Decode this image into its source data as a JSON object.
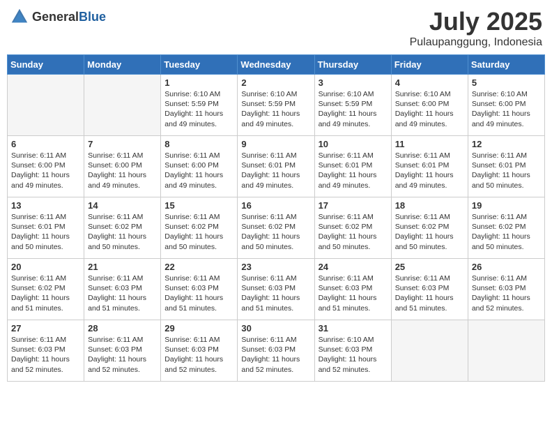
{
  "header": {
    "logo_general": "General",
    "logo_blue": "Blue",
    "month_year": "July 2025",
    "location": "Pulaupanggung, Indonesia"
  },
  "days_of_week": [
    "Sunday",
    "Monday",
    "Tuesday",
    "Wednesday",
    "Thursday",
    "Friday",
    "Saturday"
  ],
  "weeks": [
    [
      {
        "day": "",
        "empty": true
      },
      {
        "day": "",
        "empty": true
      },
      {
        "day": "1",
        "lines": [
          "Sunrise: 6:10 AM",
          "Sunset: 5:59 PM",
          "Daylight: 11 hours",
          "and 49 minutes."
        ]
      },
      {
        "day": "2",
        "lines": [
          "Sunrise: 6:10 AM",
          "Sunset: 5:59 PM",
          "Daylight: 11 hours",
          "and 49 minutes."
        ]
      },
      {
        "day": "3",
        "lines": [
          "Sunrise: 6:10 AM",
          "Sunset: 5:59 PM",
          "Daylight: 11 hours",
          "and 49 minutes."
        ]
      },
      {
        "day": "4",
        "lines": [
          "Sunrise: 6:10 AM",
          "Sunset: 6:00 PM",
          "Daylight: 11 hours",
          "and 49 minutes."
        ]
      },
      {
        "day": "5",
        "lines": [
          "Sunrise: 6:10 AM",
          "Sunset: 6:00 PM",
          "Daylight: 11 hours",
          "and 49 minutes."
        ]
      }
    ],
    [
      {
        "day": "6",
        "lines": [
          "Sunrise: 6:11 AM",
          "Sunset: 6:00 PM",
          "Daylight: 11 hours",
          "and 49 minutes."
        ]
      },
      {
        "day": "7",
        "lines": [
          "Sunrise: 6:11 AM",
          "Sunset: 6:00 PM",
          "Daylight: 11 hours",
          "and 49 minutes."
        ]
      },
      {
        "day": "8",
        "lines": [
          "Sunrise: 6:11 AM",
          "Sunset: 6:00 PM",
          "Daylight: 11 hours",
          "and 49 minutes."
        ]
      },
      {
        "day": "9",
        "lines": [
          "Sunrise: 6:11 AM",
          "Sunset: 6:01 PM",
          "Daylight: 11 hours",
          "and 49 minutes."
        ]
      },
      {
        "day": "10",
        "lines": [
          "Sunrise: 6:11 AM",
          "Sunset: 6:01 PM",
          "Daylight: 11 hours",
          "and 49 minutes."
        ]
      },
      {
        "day": "11",
        "lines": [
          "Sunrise: 6:11 AM",
          "Sunset: 6:01 PM",
          "Daylight: 11 hours",
          "and 49 minutes."
        ]
      },
      {
        "day": "12",
        "lines": [
          "Sunrise: 6:11 AM",
          "Sunset: 6:01 PM",
          "Daylight: 11 hours",
          "and 50 minutes."
        ]
      }
    ],
    [
      {
        "day": "13",
        "lines": [
          "Sunrise: 6:11 AM",
          "Sunset: 6:01 PM",
          "Daylight: 11 hours",
          "and 50 minutes."
        ]
      },
      {
        "day": "14",
        "lines": [
          "Sunrise: 6:11 AM",
          "Sunset: 6:02 PM",
          "Daylight: 11 hours",
          "and 50 minutes."
        ]
      },
      {
        "day": "15",
        "lines": [
          "Sunrise: 6:11 AM",
          "Sunset: 6:02 PM",
          "Daylight: 11 hours",
          "and 50 minutes."
        ]
      },
      {
        "day": "16",
        "lines": [
          "Sunrise: 6:11 AM",
          "Sunset: 6:02 PM",
          "Daylight: 11 hours",
          "and 50 minutes."
        ]
      },
      {
        "day": "17",
        "lines": [
          "Sunrise: 6:11 AM",
          "Sunset: 6:02 PM",
          "Daylight: 11 hours",
          "and 50 minutes."
        ]
      },
      {
        "day": "18",
        "lines": [
          "Sunrise: 6:11 AM",
          "Sunset: 6:02 PM",
          "Daylight: 11 hours",
          "and 50 minutes."
        ]
      },
      {
        "day": "19",
        "lines": [
          "Sunrise: 6:11 AM",
          "Sunset: 6:02 PM",
          "Daylight: 11 hours",
          "and 50 minutes."
        ]
      }
    ],
    [
      {
        "day": "20",
        "lines": [
          "Sunrise: 6:11 AM",
          "Sunset: 6:02 PM",
          "Daylight: 11 hours",
          "and 51 minutes."
        ]
      },
      {
        "day": "21",
        "lines": [
          "Sunrise: 6:11 AM",
          "Sunset: 6:03 PM",
          "Daylight: 11 hours",
          "and 51 minutes."
        ]
      },
      {
        "day": "22",
        "lines": [
          "Sunrise: 6:11 AM",
          "Sunset: 6:03 PM",
          "Daylight: 11 hours",
          "and 51 minutes."
        ]
      },
      {
        "day": "23",
        "lines": [
          "Sunrise: 6:11 AM",
          "Sunset: 6:03 PM",
          "Daylight: 11 hours",
          "and 51 minutes."
        ]
      },
      {
        "day": "24",
        "lines": [
          "Sunrise: 6:11 AM",
          "Sunset: 6:03 PM",
          "Daylight: 11 hours",
          "and 51 minutes."
        ]
      },
      {
        "day": "25",
        "lines": [
          "Sunrise: 6:11 AM",
          "Sunset: 6:03 PM",
          "Daylight: 11 hours",
          "and 51 minutes."
        ]
      },
      {
        "day": "26",
        "lines": [
          "Sunrise: 6:11 AM",
          "Sunset: 6:03 PM",
          "Daylight: 11 hours",
          "and 52 minutes."
        ]
      }
    ],
    [
      {
        "day": "27",
        "lines": [
          "Sunrise: 6:11 AM",
          "Sunset: 6:03 PM",
          "Daylight: 11 hours",
          "and 52 minutes."
        ]
      },
      {
        "day": "28",
        "lines": [
          "Sunrise: 6:11 AM",
          "Sunset: 6:03 PM",
          "Daylight: 11 hours",
          "and 52 minutes."
        ]
      },
      {
        "day": "29",
        "lines": [
          "Sunrise: 6:11 AM",
          "Sunset: 6:03 PM",
          "Daylight: 11 hours",
          "and 52 minutes."
        ]
      },
      {
        "day": "30",
        "lines": [
          "Sunrise: 6:11 AM",
          "Sunset: 6:03 PM",
          "Daylight: 11 hours",
          "and 52 minutes."
        ]
      },
      {
        "day": "31",
        "lines": [
          "Sunrise: 6:10 AM",
          "Sunset: 6:03 PM",
          "Daylight: 11 hours",
          "and 52 minutes."
        ]
      },
      {
        "day": "",
        "empty": true
      },
      {
        "day": "",
        "empty": true
      }
    ]
  ]
}
